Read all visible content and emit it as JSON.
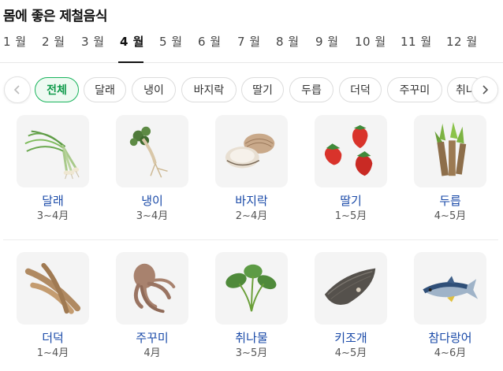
{
  "page": {
    "title": "몸에 좋은 제철음식"
  },
  "months": [
    "1 월",
    "2 월",
    "3 월",
    "4 월",
    "5 월",
    "6 월",
    "7 월",
    "8 월",
    "9 월",
    "10 월",
    "11 월",
    "12 월"
  ],
  "selected_month": "4 월",
  "chips": [
    "전체",
    "달래",
    "냉이",
    "바지락",
    "딸기",
    "두릅",
    "더덕",
    "주꾸미",
    "취나"
  ],
  "selected_chip": "전체",
  "foods": [
    {
      "name": "달래",
      "period": "3~4月",
      "icon": "dallae-icon"
    },
    {
      "name": "냉이",
      "period": "3~4月",
      "icon": "naengi-icon"
    },
    {
      "name": "바지락",
      "period": "2~4月",
      "icon": "clam-icon"
    },
    {
      "name": "딸기",
      "period": "1~5月",
      "icon": "strawberry-icon"
    },
    {
      "name": "두릅",
      "period": "4~5月",
      "icon": "dureup-icon"
    },
    {
      "name": "더덕",
      "period": "1~4月",
      "icon": "deodeok-icon"
    },
    {
      "name": "주꾸미",
      "period": "4月",
      "icon": "octopus-icon"
    },
    {
      "name": "취나물",
      "period": "3~5月",
      "icon": "chwinamul-icon"
    },
    {
      "name": "키조개",
      "period": "4~5月",
      "icon": "pen-shell-icon"
    },
    {
      "name": "참다랑어",
      "period": "4~6月",
      "icon": "tuna-icon"
    }
  ]
}
